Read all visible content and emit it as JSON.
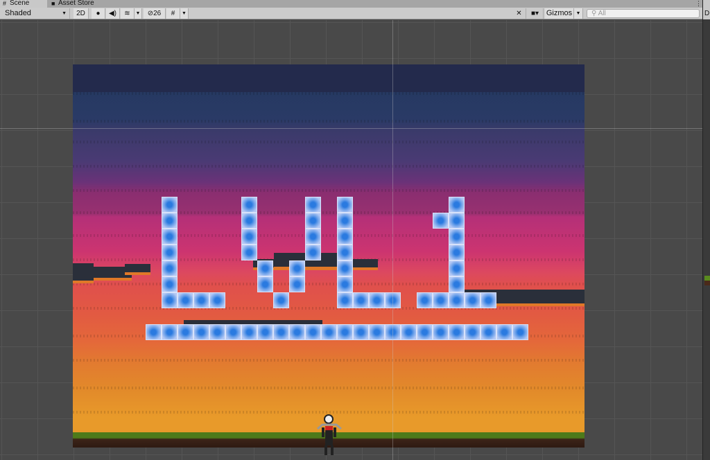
{
  "tabs": [
    {
      "label": "Scene",
      "icon": "grid-icon"
    },
    {
      "label": "Asset Store",
      "icon": "bag-icon"
    }
  ],
  "toolbar": {
    "shading_mode": "Shaded",
    "mode_2d": "2D",
    "hidden_count": "26",
    "gizmos": "Gizmos",
    "search_placeholder": "All"
  },
  "right_panel": {
    "label": "D"
  }
}
